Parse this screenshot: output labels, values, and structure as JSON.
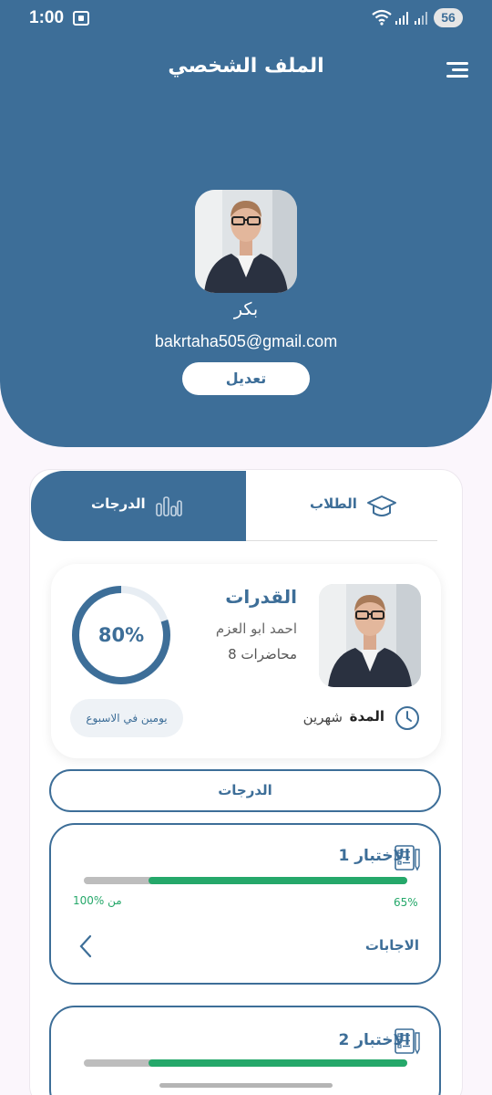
{
  "status_bar": {
    "time": "1:00",
    "battery": "56"
  },
  "header": {
    "title": "الملف الشخصي"
  },
  "profile": {
    "name": "بكر",
    "email": "bakrtaha505@gmail.com",
    "edit_label": "تعديل"
  },
  "tabs": [
    {
      "label": "الدرجات",
      "icon": "bar-chart-icon",
      "active": true
    },
    {
      "label": "الطلاب",
      "icon": "graduation-cap-icon",
      "active": false
    }
  ],
  "course": {
    "title": "القدرات",
    "teacher": "احمد ابو العزم",
    "lectures": "8 محاضرات",
    "duration_label": "المدة",
    "duration_value": "شهرين",
    "progress_text": "80%",
    "progress": 0.8,
    "frequency": "يومين في الاسبوع"
  },
  "grades_button": "الدرجات",
  "tests": [
    {
      "title": "الاختبار 1",
      "score": "65%",
      "total": "100% من",
      "fill": 0.8,
      "answers_label": "الاجابات"
    },
    {
      "title": "الاختبار 2",
      "fill": 0.8
    }
  ],
  "colors": {
    "primary": "#3d6e98",
    "success": "#25a86a",
    "background": "#fbf6fc"
  }
}
